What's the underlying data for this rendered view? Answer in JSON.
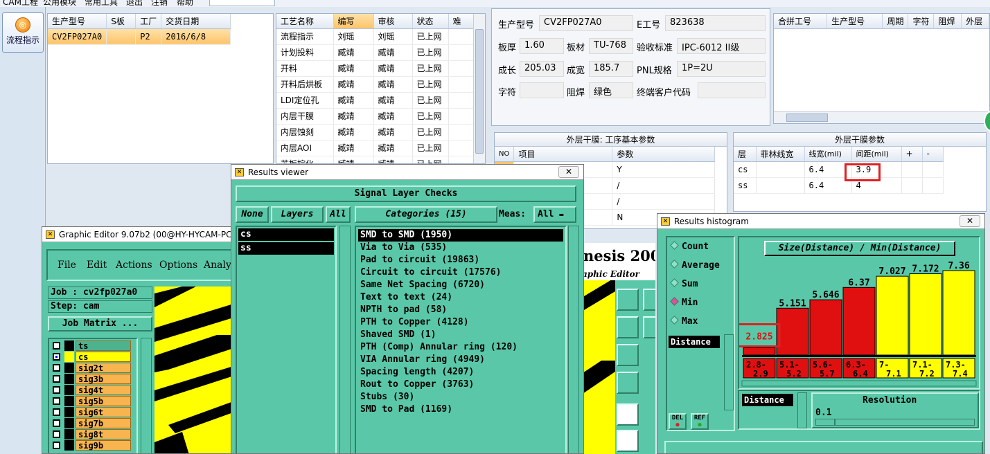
{
  "menu": [
    "CAM工程",
    "公用模块",
    "常用工具",
    "退出",
    "注销",
    "帮助"
  ],
  "flow_button": "流程指示",
  "orders": {
    "columns": [
      "生产型号",
      "S板",
      "工厂",
      "交货日期"
    ],
    "rows": [
      [
        "CV2FP027A0",
        "",
        "P2",
        "2016/6/8"
      ]
    ]
  },
  "process": {
    "columns": [
      "工艺名称",
      "编写",
      "审核",
      "状态",
      "难"
    ],
    "rows": [
      [
        "流程指示",
        "刘瑶",
        "刘瑶",
        "已上网",
        ""
      ],
      [
        "计划投料",
        "臧靖",
        "臧靖",
        "已上网",
        ""
      ],
      [
        "开料",
        "臧靖",
        "臧靖",
        "已上网",
        ""
      ],
      [
        "开料后烘板",
        "臧靖",
        "臧靖",
        "已上网",
        ""
      ],
      [
        "LDI定位孔",
        "臧靖",
        "臧靖",
        "已上网",
        ""
      ],
      [
        "内层干膜",
        "臧靖",
        "臧靖",
        "已上网",
        ""
      ],
      [
        "内层蚀刻",
        "臧靖",
        "臧靖",
        "已上网",
        ""
      ],
      [
        "内层AOI",
        "臧靖",
        "臧靖",
        "已上网",
        ""
      ],
      [
        "芯板棕化",
        "臧靖",
        "臧靖",
        "已上网",
        ""
      ]
    ]
  },
  "info": {
    "model_label": "生产型号",
    "model": "CV2FP027A0",
    "e_label": "E工号",
    "e_no": "823638",
    "thick_label": "板厚",
    "thick": "1.60",
    "material_label": "板材",
    "material": "TU-768",
    "std_label": "验收标准",
    "std": "IPC-6012 II级",
    "len_label": "成长",
    "len": "205.03",
    "wid_label": "成宽",
    "wid": "185.7",
    "pnl_label": "PNL规格",
    "pnl": "1P=2U",
    "char_label": "字符",
    "char": "",
    "mask_label": "阻焊",
    "mask": "绿色",
    "cust_label": "终端客户代码",
    "cust": ""
  },
  "merge": {
    "columns": [
      "合拼工号",
      "生产型号",
      "周期",
      "字符",
      "阻焊",
      "外层"
    ]
  },
  "outer_basic": {
    "title": "外层干膜: 工序基本参数",
    "columns": [
      "NO",
      "项目",
      "参数"
    ],
    "rows": [
      [
        "",
        "",
        "Y"
      ],
      [
        "",
        "",
        "/"
      ],
      [
        "",
        "",
        "/"
      ],
      [
        "",
        "",
        "N"
      ]
    ]
  },
  "outer_params": {
    "title": "外层干膜参数",
    "columns": [
      "层",
      "菲林线宽",
      "线宽(mil)",
      "间距(mil)",
      "+",
      "-"
    ],
    "rows": [
      [
        "cs",
        "",
        "6.4",
        "3.9",
        "",
        ""
      ],
      [
        "ss",
        "",
        "6.4",
        "4",
        "",
        ""
      ]
    ]
  },
  "results_viewer": {
    "title": "Results viewer",
    "header": "Signal Layer Checks",
    "none_btn": "None",
    "layers_btn": "Layers",
    "all_btn": "All",
    "categories_btn": "Categories (15)",
    "meas_label": "Meas:",
    "meas_value": "All",
    "layers": [
      "cs",
      "ss"
    ],
    "categories": [
      "SMD to SMD (1950)",
      "Via to Via (535)",
      "Pad to circuit (19863)",
      "Circuit to circuit (17576)",
      "Same Net Spacing (6720)",
      "Text to text (24)",
      "NPTH to pad (58)",
      "PTH to Copper (4128)",
      "Shaved SMD (1)",
      "PTH (Comp) Annular ring (120)",
      "VIA Annular ring (4949)",
      "Spacing length (4207)",
      "Rout to Copper (3763)",
      "Stubs (30)",
      "SMD to Pad (1169)"
    ]
  },
  "graphic_editor": {
    "title": "Graphic Editor 9.07b2 (00@HY-HYCAM-PC",
    "menu": [
      "File",
      "Edit",
      "Actions",
      "Options",
      "Analy"
    ],
    "job": "Job : cv2fp027a0",
    "step": "Step: cam",
    "matrix_btn": "Job Matrix ...",
    "layers": [
      "ts",
      "cs",
      "sig2t",
      "sig3b",
      "sig4t",
      "sig5b",
      "sig6t",
      "sig7b",
      "sig8t",
      "sig9b"
    ],
    "brand": "nesis 2000",
    "brand_sub": "aphic Editor"
  },
  "histogram": {
    "title": "Results histogram",
    "modes": [
      "Count",
      "Average",
      "Sum",
      "Min",
      "Max"
    ],
    "selected_mode": "Min",
    "list_item": "Distance",
    "chart_title": "Size(Distance) / Min(Distance)",
    "del_btn": "DEL",
    "ref_btn": "REF",
    "lower_label": "Distance",
    "resolution_label": "Resolution",
    "resolution_value": "0.1"
  },
  "chart_data": {
    "type": "bar",
    "title": "Size(Distance) / Min(Distance)",
    "categories": [
      "2.8-2.9",
      "5.1-5.2",
      "5.6-5.7",
      "6.3-6.4",
      "7-7.1",
      "7.1-7.2",
      "7.3-7.4"
    ],
    "values": [
      2.825,
      5.151,
      5.646,
      6.37,
      7.027,
      7.172,
      7.36
    ],
    "value_labels": [
      "2.825",
      "5.151",
      "5.646",
      "6.37",
      "7.027",
      "7.172",
      "7.36"
    ],
    "colors": [
      "#e01010",
      "#e01010",
      "#e01010",
      "#e01010",
      "#ffff00",
      "#ffff00",
      "#ffff00"
    ],
    "ylim": [
      0,
      8
    ]
  }
}
